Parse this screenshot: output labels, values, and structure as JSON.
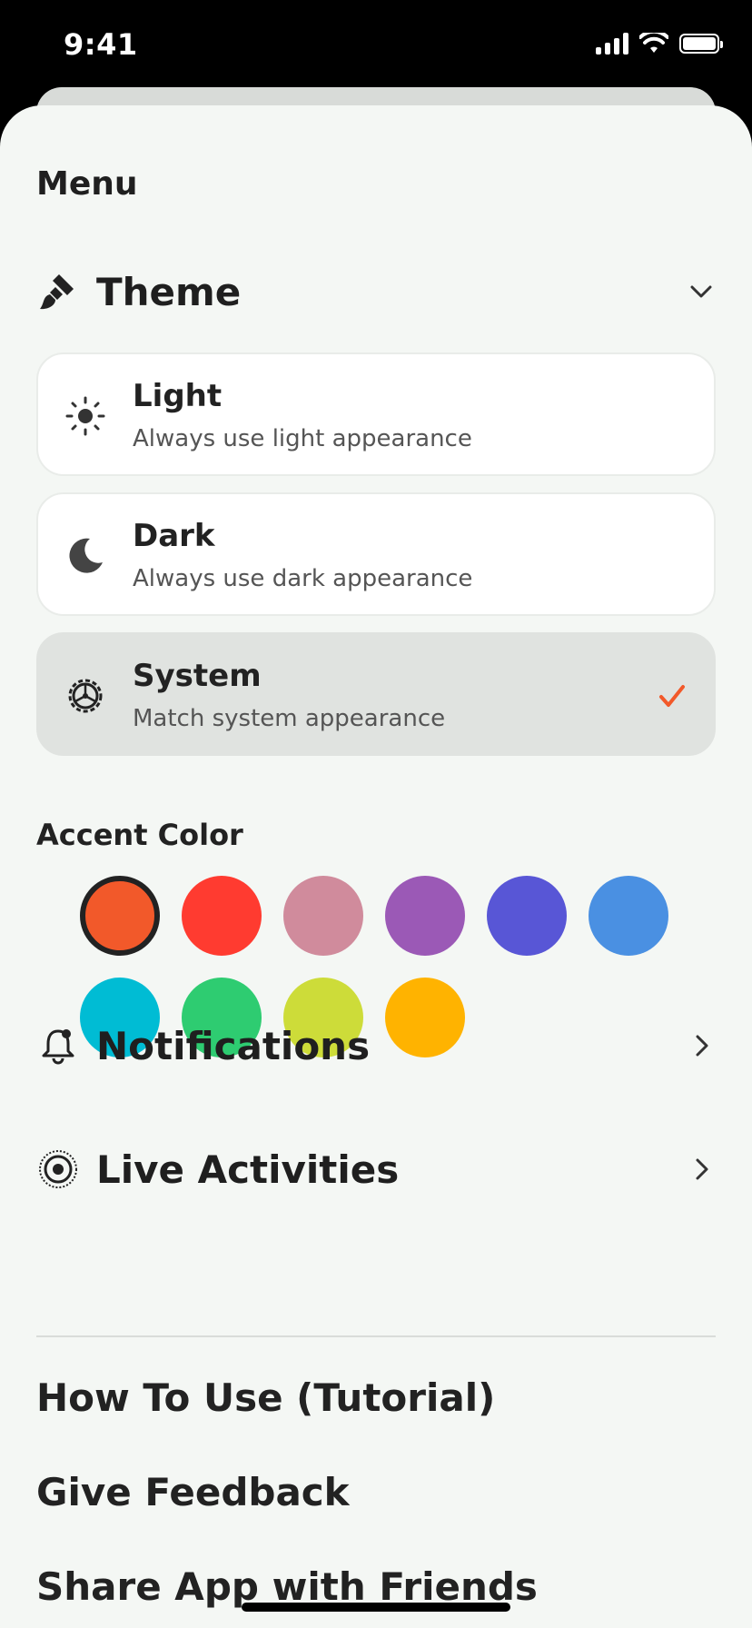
{
  "status_bar": {
    "time": "9:41"
  },
  "menu": {
    "title": "Menu"
  },
  "theme": {
    "label": "Theme",
    "options": [
      {
        "title": "Light",
        "subtitle": "Always use light appearance",
        "icon": "sun-icon",
        "selected": false
      },
      {
        "title": "Dark",
        "subtitle": "Always use dark appearance",
        "icon": "moon-icon",
        "selected": false
      },
      {
        "title": "System",
        "subtitle": "Match system appearance",
        "icon": "gear-icon",
        "selected": true
      }
    ],
    "check_color": "#f2592a"
  },
  "accent": {
    "title": "Accent Color",
    "colors": [
      "#f2592a",
      "#ff3b30",
      "#d08b9c",
      "#9b59b6",
      "#5856d6",
      "#4a90e2",
      "#00bcd4",
      "#2ecc71",
      "#cddc39",
      "#ffb300"
    ],
    "selected_index": 0
  },
  "notifications": {
    "label": "Notifications"
  },
  "live_activities": {
    "label": "Live Activities"
  },
  "links": {
    "tutorial": "How To Use (Tutorial)",
    "feedback": "Give Feedback",
    "share": "Share App with Friends"
  }
}
